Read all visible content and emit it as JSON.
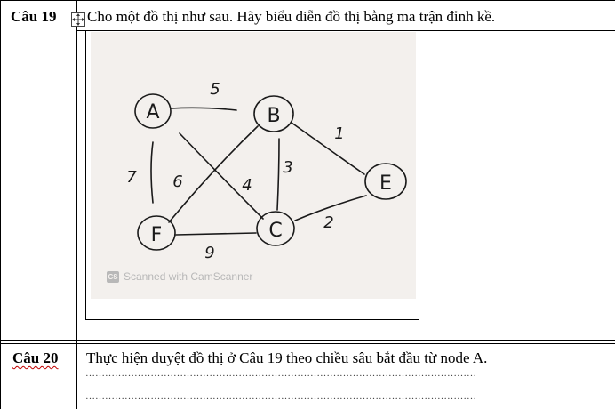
{
  "question19": {
    "label": "Câu 19",
    "text": "Cho một đồ thị như sau. Hãy biểu diễn đồ thị bằng ma trận đỉnh kề."
  },
  "figure": {
    "graph": {
      "nodes": [
        "A",
        "B",
        "E",
        "F",
        "C"
      ],
      "edges": [
        {
          "from": "A",
          "to": "B",
          "weight": "5"
        },
        {
          "from": "B",
          "to": "E",
          "weight": "1"
        },
        {
          "from": "A",
          "to": "F",
          "weight": "7"
        },
        {
          "from": "B",
          "to": "F",
          "weight": "6"
        },
        {
          "from": "A",
          "to": "C",
          "weight": "4"
        },
        {
          "from": "B",
          "to": "C",
          "weight": "3"
        },
        {
          "from": "F",
          "to": "C",
          "weight": "9"
        },
        {
          "from": "C",
          "to": "E",
          "weight": "2"
        }
      ]
    },
    "watermark_badge": "CS",
    "watermark_text": "Scanned with CamScanner"
  },
  "question20": {
    "label": "Câu 20",
    "text": "Thực hiện duyệt đồ thị ở Câu 19 theo chiều sâu bắt đầu từ node A."
  },
  "answer_lines": {
    "line1": "…………………………………………………………………………………………………………",
    "line2": "…………………………………………………………………………………………………………"
  }
}
